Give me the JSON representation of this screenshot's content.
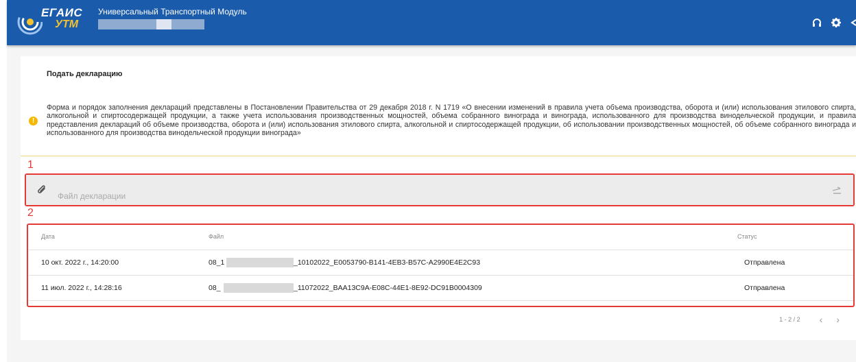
{
  "header": {
    "logo_top": "ЕГАИС",
    "logo_bottom": "УТМ",
    "app_title": "Универсальный Транспортный Модуль",
    "icons": [
      "headset-icon",
      "gear-icon",
      "logout-icon"
    ]
  },
  "page": {
    "title": "Подать декларацию",
    "notice": "Форма и порядок заполнения деклараций представлены в Постановлении Правительства от 29 декабря 2018 г. N 1719 «О внесении изменений в правила учета объема производства, оборота и (или) использования этилового спирта, алкогольной и спиртосодержащей продукции, а также учета использования производственных мощностей, объема собранного винограда и винограда, использованного для производства винодельческой продукции, и правила представления деклараций об объеме производства, оборота и (или) использования этилового спирта, алкогольной и спиртосодержащей продукции, об использовании производственных мощностей, об объеме собранного винограда и использованного для производства винодельческой продукции винограда»"
  },
  "annotations": {
    "box1": "1",
    "box2": "2"
  },
  "file_input": {
    "placeholder": "Файл декларации"
  },
  "table": {
    "headers": {
      "date": "Дата",
      "file": "Файл",
      "status": "Статус"
    },
    "rows": [
      {
        "date": "10 окт. 2022 г., 14:20:00",
        "file_prefix": "08_1",
        "file_suffix": "_10102022_E0053790-B141-4EB3-B57C-A2990E4E2C93",
        "status": "Отправлена"
      },
      {
        "date": "11 июл. 2022 г., 14:28:16",
        "file_prefix": "08_",
        "file_suffix": "_11072022_BAA13C9A-E08C-44E1-8E92-DC91B0004309",
        "status": "Отправлена"
      }
    ]
  },
  "pagination": {
    "range": "1 - 2 / 2",
    "prev": "‹",
    "next": "›"
  },
  "colors": {
    "header_bg": "#1a5bab",
    "logo_accent": "#f2c230",
    "annotation_red": "#e53935",
    "warning": "#f5b800"
  }
}
